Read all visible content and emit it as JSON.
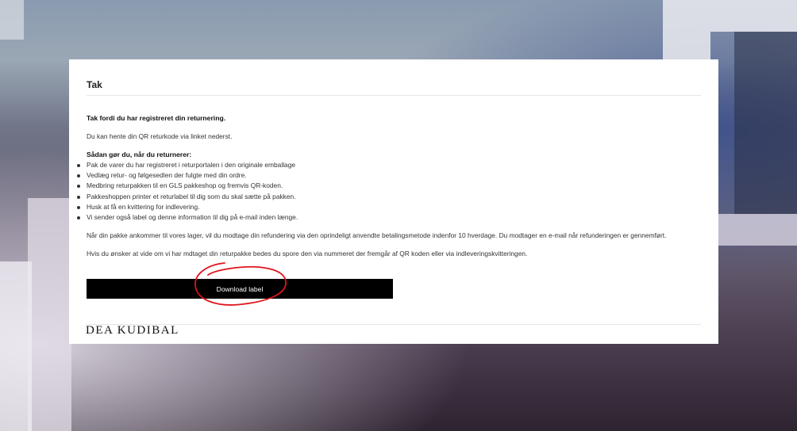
{
  "card": {
    "title": "Tak",
    "thanks": "Tak fordi du har registreret din returnering.",
    "qr_info": "Du kan hente din QR returkode via linket nederst.",
    "howto_heading": "Sådan gør du, når du returnerer:",
    "steps": [
      "Pak de varer du har registreret i returportalen i den originale emballage",
      "Vedlæg retur- og følgesedlen der fulgte med din ordre.",
      "Medbring returpakken til en GLS pakkeshop og fremvis QR-koden.",
      "Pakkeshoppen printer et returlabel til dig som du skal sætte på pakken.",
      "Husk at få en kvittering for indlevering.",
      "Vi sender også label og denne information til dig på e-mail inden længe."
    ],
    "refund_info": "Når din pakke ankommer til vores lager, vil du modtage din refundering via den oprindeligt anvendte betalingsmetode indenfor 10 hverdage. Du modtager en e-mail når refunderingen er gennemført.",
    "tracking_info": "Hvis du ønsker at vide om vi har mdtaget din returpakke bedes du spore den via nummeret der fremgår af QR koden eller via indleveringskvitteringen.",
    "download_label": "Download label",
    "logo": "DEA KUDIBAL"
  },
  "colors": {
    "button_bg": "#000000",
    "button_text": "#ffffff",
    "annotation": "#e0141c"
  }
}
